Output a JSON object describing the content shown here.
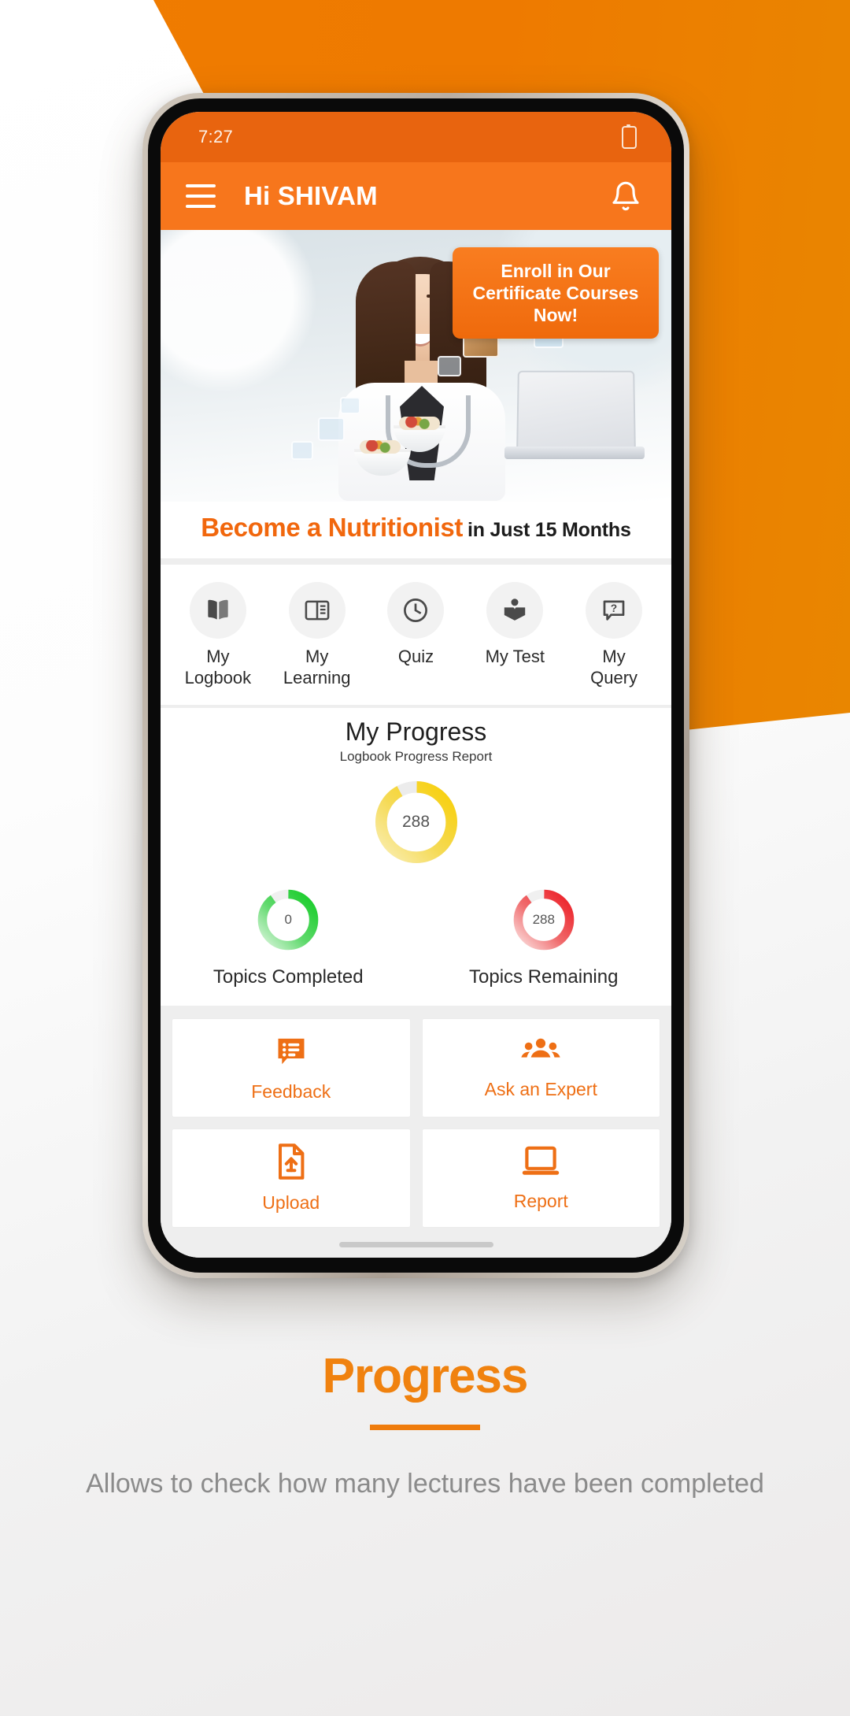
{
  "status_bar": {
    "time": "7:27",
    "battery_icon": "battery-icon"
  },
  "app_bar": {
    "menu_icon": "hamburger-menu-icon",
    "title": "Hi SHIVAM",
    "notification_icon": "bell-icon"
  },
  "banner": {
    "cta_label": "Enroll in Our Certificate Courses Now!",
    "caption_strong": "Become a Nutritionist",
    "caption_sub": "in Just 15 Months"
  },
  "quick_actions": [
    {
      "label": "My\nLogbook",
      "label_line1": "My",
      "label_line2": "Logbook",
      "icon": "open-book-icon"
    },
    {
      "label": "My\nLearning",
      "label_line1": "My",
      "label_line2": "Learning",
      "icon": "book-page-icon"
    },
    {
      "label": "Quiz",
      "label_line1": "Quiz",
      "label_line2": "",
      "icon": "clock-icon"
    },
    {
      "label": "My Test",
      "label_line1": "My Test",
      "label_line2": "",
      "icon": "reader-book-icon"
    },
    {
      "label": "My\nQuery",
      "label_line1": "My",
      "label_line2": "Query",
      "icon": "question-chat-icon"
    }
  ],
  "progress": {
    "title": "My Progress",
    "subtitle": "Logbook Progress Report",
    "main_value": "288",
    "sub": [
      {
        "value": "0",
        "label": "Topics Completed",
        "color": "#23cc3a"
      },
      {
        "value": "288",
        "label": "Topics Remaining",
        "color": "#ec2029"
      }
    ]
  },
  "tiles": [
    {
      "label": "Feedback",
      "icon": "feedback-chat-list-icon"
    },
    {
      "label": "Ask an Expert",
      "icon": "group-people-icon"
    },
    {
      "label": "Upload",
      "icon": "file-upload-icon"
    },
    {
      "label": "Report",
      "icon": "laptop-report-icon"
    }
  ],
  "footer": {
    "title": "Progress",
    "description": "Allows to check how many lectures have been completed"
  },
  "colors": {
    "brand_orange": "#f7761c",
    "status_orange": "#e8640f",
    "hero_orange": "#ef7c00",
    "gauge_yellow": "#f6d014",
    "gauge_green": "#23cc3a",
    "gauge_red": "#ec2029",
    "tile_label": "#ee6f15",
    "footer_gray": "#8b8b8b"
  },
  "chart_data": {
    "type": "pie",
    "title": "My Progress",
    "subtitle": "Logbook Progress Report",
    "series": [
      {
        "name": "Logbook Progress",
        "value": 288,
        "max": 300,
        "percent": 92,
        "color": "#f6d014"
      },
      {
        "name": "Topics Completed",
        "value": 0,
        "max": 288,
        "percent": 90,
        "color": "#23cc3a"
      },
      {
        "name": "Topics Remaining",
        "value": 288,
        "max": 288,
        "percent": 90,
        "color": "#ec2029"
      }
    ],
    "legend_position": "below",
    "grid": false
  }
}
